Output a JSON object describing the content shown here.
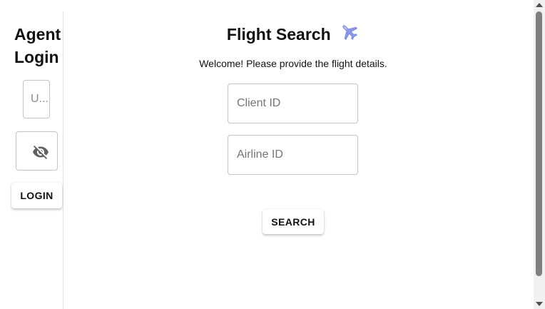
{
  "sidebar": {
    "title_line1": "Agent",
    "title_line2": "Login",
    "username_placeholder": "U...",
    "password_toggle_icon": "eye-off-icon",
    "login_label": "LOGIN"
  },
  "main": {
    "title": "Flight Search",
    "title_icon": "airplane-icon",
    "welcome": "Welcome! Please provide the flight details.",
    "client_id_placeholder": "Client ID",
    "airline_id_placeholder": "Airline ID",
    "search_label": "SEARCH"
  },
  "colors": {
    "border": "#c4c4c4",
    "icon_gray": "#616161",
    "plane_accent": "#7f8ce6"
  }
}
